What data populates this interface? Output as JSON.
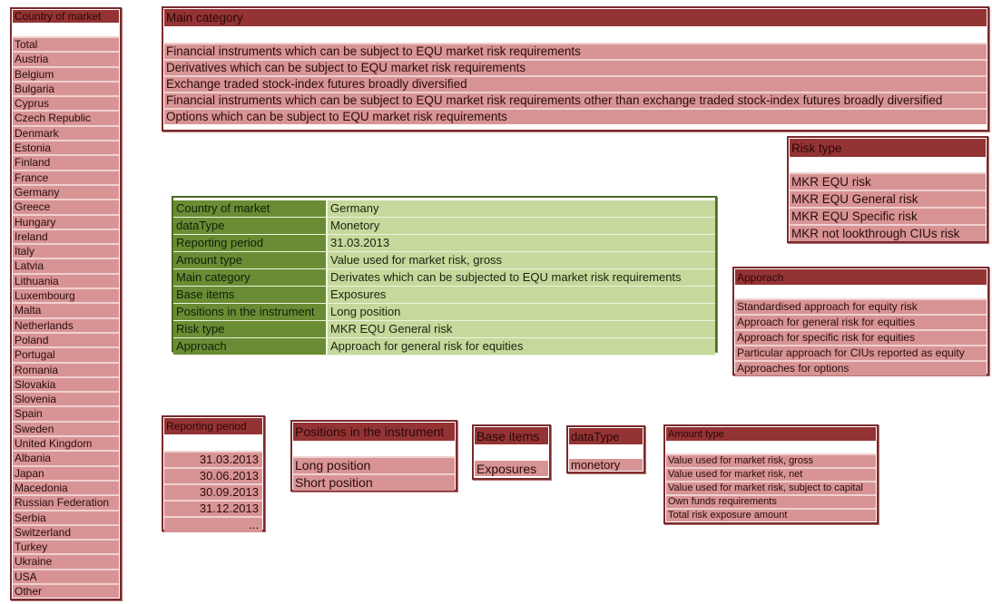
{
  "colors": {
    "header_red": "#943334",
    "row_pink": "#d89494",
    "border_red": "#7a2a2e",
    "key_green": "#6b8c34",
    "value_green": "#c5d99c"
  },
  "country": {
    "title": "Country of market",
    "items": [
      "Total",
      "Austria",
      "Belgium",
      "Bulgaria",
      "Cyprus",
      "Czech Republic",
      "Denmark",
      "Estonia",
      "Finland",
      "France",
      "Germany",
      "Greece",
      "Hungary",
      "Ireland",
      "Italy",
      "Latvia",
      "Lithuania",
      "Luxembourg",
      "Malta",
      "Netherlands",
      "Poland",
      "Portugal",
      "Romania",
      "Slovakia",
      "Slovenia",
      "Spain",
      "Sweden",
      "United Kingdom",
      "Albania",
      "Japan",
      "Macedonia",
      "Russian Federation",
      "Serbia",
      "Switzerland",
      "Turkey",
      "Ukraine",
      "USA",
      "Other"
    ]
  },
  "main_category": {
    "title": "Main category",
    "items": [
      "Financial instruments which can be subject to EQU market risk requirements",
      "Derivatives which can be subject to EQU market risk requirements",
      "Exchange traded stock-index futures broadly diversified",
      "Financial instruments which can be subject to EQU market risk requirements other than exchange traded stock-index futures broadly diversified",
      "Options which can be subject to EQU market risk requirements"
    ]
  },
  "risk_type": {
    "title": "Risk type",
    "items": [
      "MKR EQU risk",
      "MKR EQU General risk",
      "MKR EQU Specific risk",
      "MKR not lookthrough CIUs risk"
    ]
  },
  "approach": {
    "title": "Apporach",
    "items": [
      "Standardised approach for equity risk",
      "Approach for general risk for equities",
      "Approach for specific risk for equities",
      "Particular approach for CIUs reported as equity",
      "Approaches for options"
    ]
  },
  "summary": {
    "rows": [
      {
        "key": "Country of market",
        "value": "Germany"
      },
      {
        "key": "dataType",
        "value": "Monetory"
      },
      {
        "key": "Reporting period",
        "value": "31.03.2013"
      },
      {
        "key": "Amount type",
        "value": "Value used for market risk, gross"
      },
      {
        "key": "Main category",
        "value": "Derivates which can be subjected to EQU market risk requirements"
      },
      {
        "key": "Base items",
        "value": "Exposures"
      },
      {
        "key": "Positions in the instrument",
        "value": "Long position"
      },
      {
        "key": "Risk type",
        "value": "MKR EQU General risk"
      },
      {
        "key": "Approach",
        "value": "Approach for general risk for equities"
      }
    ]
  },
  "reporting_period": {
    "title": "Reporting period",
    "items": [
      "31.03.2013",
      "30.06.2013",
      "30.09.2013",
      "31.12.2013",
      "..."
    ]
  },
  "positions": {
    "title": "Positions in the instrument",
    "items": [
      "Long position",
      "Short position"
    ]
  },
  "base_items": {
    "title": "Base items",
    "items": [
      "Exposures"
    ]
  },
  "data_type": {
    "title": "dataType",
    "items": [
      "monetory"
    ]
  },
  "amount_type": {
    "title": "Amount type",
    "items": [
      "Value used for market risk, gross",
      "Value used for market risk, net",
      "Value used for market risk, subject to capital",
      "Own funds requirements",
      "Total risk exposure amount"
    ]
  }
}
